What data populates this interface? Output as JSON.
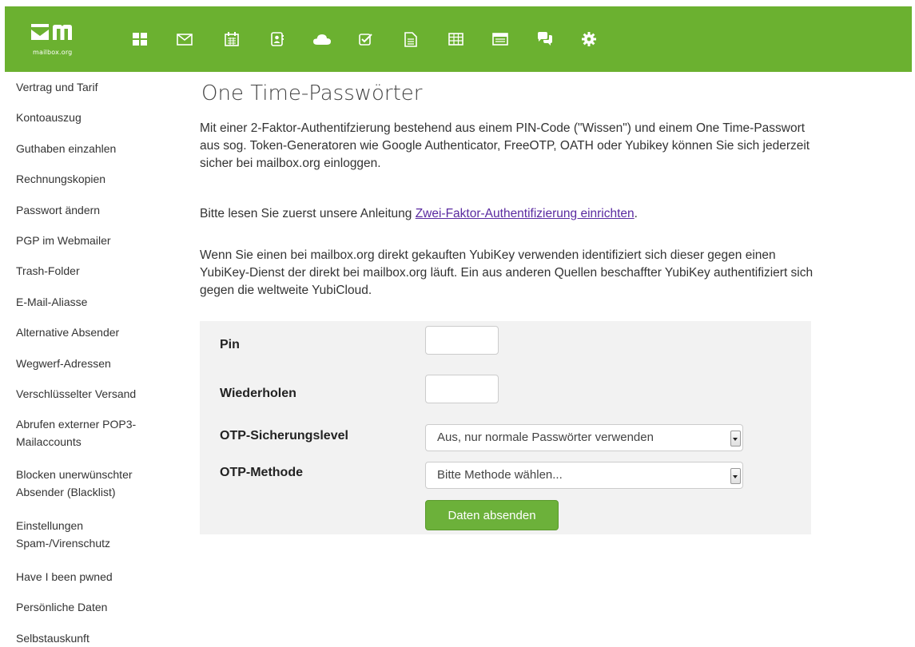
{
  "brand": {
    "logo_text": "mailbox.org",
    "primary_color": "#6bb130",
    "link_color": "#5a2aa0"
  },
  "topbar": {
    "icons": [
      "apps-grid-icon",
      "mail-icon",
      "calendar-icon",
      "contacts-icon",
      "cloud-icon",
      "tasks-icon",
      "document-icon",
      "spreadsheet-icon",
      "presentation-icon",
      "chat-icon",
      "settings-gear-icon"
    ]
  },
  "sidebar": {
    "items": [
      {
        "label": "Vertrag und Tarif"
      },
      {
        "label": "Kontoauszug"
      },
      {
        "label": "Guthaben einzahlen"
      },
      {
        "label": "Rechnungskopien"
      },
      {
        "label": "Passwort ändern"
      },
      {
        "label": "PGP im Webmailer"
      },
      {
        "label": "Trash-Folder"
      },
      {
        "label": "E-Mail-Aliasse"
      },
      {
        "label": "Alternative Absender"
      },
      {
        "label": "Wegwerf-Adressen"
      },
      {
        "label": "Verschlüsselter Versand"
      },
      {
        "label": "Abrufen externer POP3-Mailaccounts"
      },
      {
        "label": "Blocken unerwünschter Absender (Blacklist)"
      },
      {
        "label": "Einstellungen Spam-/Virenschutz"
      },
      {
        "label": "Have I been pwned"
      },
      {
        "label": "Persönliche Daten"
      },
      {
        "label": "Selbstauskunft"
      }
    ]
  },
  "main": {
    "title": "One Time-Passwörter",
    "intro": "Mit einer 2-Faktor-Authentifzierung bestehend aus einem PIN-Code (\"Wissen\") und einem One Time-Passwort aus sog. Token-Generatoren wie Google Authenticator, FreeOTP, OATH oder Yubikey können Sie sich jederzeit sicher bei mailbox.org einloggen.",
    "guide_prefix": "Bitte lesen Sie zuerst unsere Anleitung ",
    "guide_link": "Zwei-Faktor-Authentifizierung einrichten",
    "guide_suffix": ".",
    "yubikey_note": "Wenn Sie einen bei mailbox.org direkt gekauften YubiKey verwenden identifiziert sich dieser gegen einen YubiKey-Dienst der direkt bei mailbox.org läuft. Ein aus anderen Quellen beschaffter YubiKey authentifiziert sich gegen die weltweite YubiCloud."
  },
  "form": {
    "pin_label": "Pin",
    "pin_value": "",
    "repeat_label": "Wiederholen",
    "repeat_value": "",
    "level_label": "OTP-Sicherungslevel",
    "level_value": "Aus, nur normale Passwörter verwenden",
    "method_label": "OTP-Methode",
    "method_value": "Bitte Methode wählen...",
    "submit_label": "Daten absenden"
  }
}
